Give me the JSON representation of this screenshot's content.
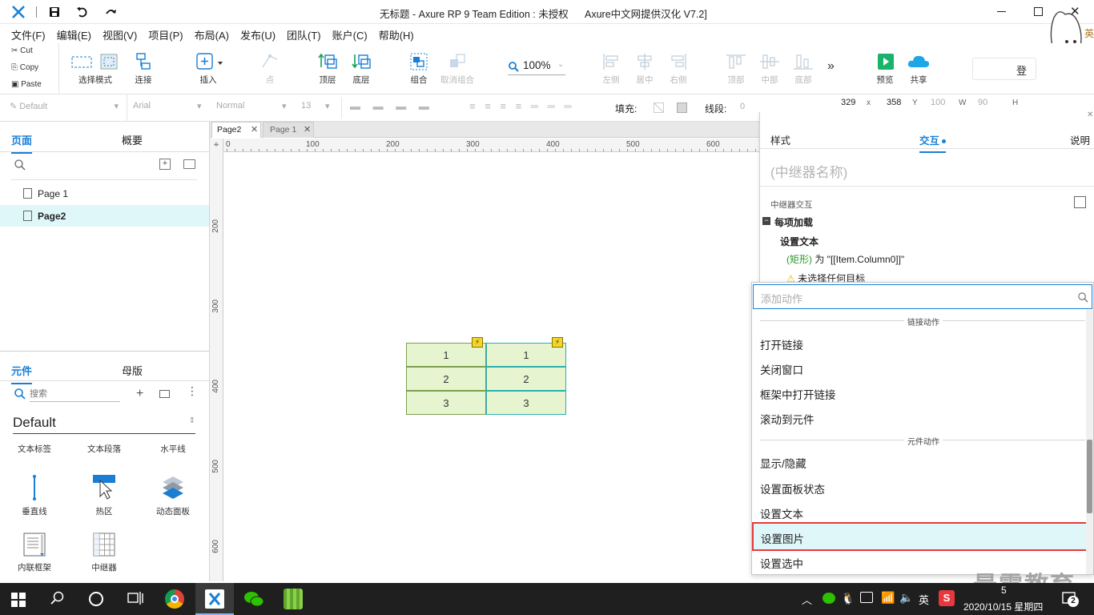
{
  "window": {
    "title": "无标题 - Axure RP 9 Team Edition : 未授权",
    "subtitle": "Axure中文网提供汉化 V7.2]"
  },
  "menu": [
    "文件(F)",
    "编辑(E)",
    "视图(V)",
    "项目(P)",
    "布局(A)",
    "发布(U)",
    "团队(T)",
    "账户(C)",
    "帮助(H)"
  ],
  "clipboard": {
    "cut": "Cut",
    "copy": "Copy",
    "paste": "Paste"
  },
  "toolbar": {
    "select_mode": "选择模式",
    "connect": "连接",
    "insert": "插入",
    "point": "点",
    "top": "顶层",
    "bottom": "底层",
    "group": "组合",
    "ungroup": "取消组合",
    "zoom": "100%",
    "left": "左侧",
    "center": "居中",
    "right": "右侧",
    "top_align": "顶部",
    "middle": "中部",
    "bottom_align": "底部",
    "preview": "预览",
    "share": "共享",
    "login": "登"
  },
  "format": {
    "style": "Default",
    "font": "Arial",
    "weight": "Normal",
    "size": "13",
    "fill_label": "填充:",
    "line_label": "线段:",
    "line_val": "0",
    "x": "329",
    "x_label": "x",
    "y": "358",
    "y_label": "Y",
    "w": "100",
    "w_label": "W",
    "h": "90",
    "h_label": "H"
  },
  "pages_panel": {
    "tab_pages": "页面",
    "tab_outline": "概要",
    "pages": [
      "Page 1",
      "Page2"
    ],
    "selected": "Page2"
  },
  "widgets_panel": {
    "tab_widgets": "元件",
    "tab_masters": "母版",
    "search_placeholder": "搜索",
    "library": "Default",
    "items": [
      "文本标签",
      "文本段落",
      "水平线",
      "垂直线",
      "热区",
      "动态面板",
      "内联框架",
      "中继器"
    ]
  },
  "canvas": {
    "tabs": [
      "Page2",
      "Page 1"
    ],
    "active_tab": "Page2",
    "ruler_h": [
      "0",
      "100",
      "200",
      "300",
      "400",
      "500",
      "600"
    ],
    "ruler_v": [
      "200",
      "300",
      "400",
      "500",
      "600"
    ],
    "repeater": [
      [
        "1",
        "1"
      ],
      [
        "2",
        "2"
      ],
      [
        "3",
        "3"
      ]
    ]
  },
  "right_panel": {
    "tab_style": "样式",
    "tab_interaction": "交互",
    "tab_notes": "说明",
    "name_placeholder": "(中继器名称)",
    "section": "中继器交互",
    "event": "每项加载",
    "action": "设置文本",
    "target_green": "(矩形)",
    "target_text": "为 \"[[Item.Column0]]\"",
    "warning": "未选择任何目标"
  },
  "action_dropdown": {
    "placeholder": "添加动作",
    "group_links": "链接动作",
    "links": [
      "打开链接",
      "关闭窗口",
      "框架中打开链接",
      "滚动到元件"
    ],
    "group_widgets": "元件动作",
    "widgets": [
      "显示/隐藏",
      "设置面板状态",
      "设置文本",
      "设置图片",
      "设置选中"
    ],
    "highlighted": "设置图片"
  },
  "watermark": "最需教育",
  "taskbar": {
    "ime": "英",
    "date": "2020/10/15 星期四",
    "notif_count": "2",
    "time_partial": "5"
  },
  "colors": {
    "accent": "#1a7fd4",
    "highlight_border": "#e8383d",
    "highlight_bg": "#e0f7f9",
    "repeater_fill": "#e6f5d0"
  }
}
